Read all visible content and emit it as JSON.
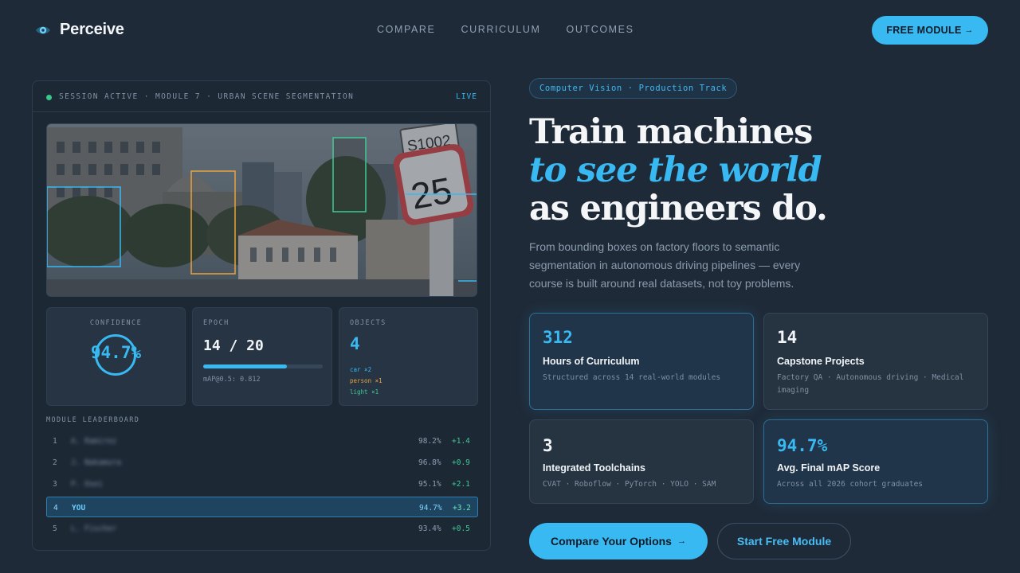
{
  "nav": {
    "brand": "Perceive",
    "links": [
      "COMPARE",
      "CURRICULUM",
      "OUTCOMES"
    ],
    "cta": "FREE MODULE",
    "cta_arrow": "→"
  },
  "session": {
    "status": "SESSION ACTIVE · MODULE 7 · URBAN SCENE SEGMENTATION",
    "live": "LIVE"
  },
  "metrics": {
    "confidence_label": "CONFIDENCE",
    "confidence_value": "94.7%",
    "epoch_label": "EPOCH",
    "epoch_value": "14 / 20",
    "epoch_progress": 0.7,
    "map_text": "mAP@0.5: 0.812",
    "objects_label": "OBJECTS",
    "objects_value": "4",
    "objects_list": [
      "car ×2",
      "person ×1",
      "light ×1"
    ]
  },
  "leaderboard": {
    "label": "MODULE LEADERBOARD",
    "rows": [
      {
        "rank": "1",
        "name": "A. Ramirez",
        "score": "98.2%",
        "delta": "+1.4"
      },
      {
        "rank": "2",
        "name": "J. Nakamura",
        "score": "96.8%",
        "delta": "+0.9"
      },
      {
        "rank": "3",
        "name": "P. Osei",
        "score": "95.1%",
        "delta": "+2.1"
      },
      {
        "rank": "4",
        "name": "YOU",
        "score": "94.7%",
        "delta": "+3.2"
      },
      {
        "rank": "5",
        "name": "L. Fischer",
        "score": "93.4%",
        "delta": "+0.5"
      }
    ]
  },
  "hero": {
    "tag": "Computer Vision · Production Track",
    "line1": "Train machines",
    "line2": "to see the world",
    "line3": "as engineers do.",
    "lead": "From bounding boxes on factory floors to semantic segmentation in autonomous driving pipelines — every course is built around real datasets, not toy problems."
  },
  "stats": [
    {
      "num": "312",
      "title": "Hours of Curriculum",
      "sub": "Structured across 14 real-world modules"
    },
    {
      "num": "14",
      "title": "Capstone Projects",
      "sub": "Factory QA · Autonomous driving · Medical imaging"
    },
    {
      "num": "3",
      "title": "Integrated Toolchains",
      "sub": "CVAT · Roboflow · PyTorch · YOLO · SAM"
    },
    {
      "num": "94.7%",
      "title": "Avg. Final mAP Score",
      "sub": "Across all 2026 cohort graduates"
    }
  ],
  "buttons": {
    "primary": "Compare Your Options",
    "primary_arrow": "→",
    "secondary": "Start Free Module"
  },
  "colors": {
    "accent": "#38b9f2",
    "background": "#1f2a38",
    "positive": "#3ec994",
    "status_dot": "#36c98a"
  }
}
